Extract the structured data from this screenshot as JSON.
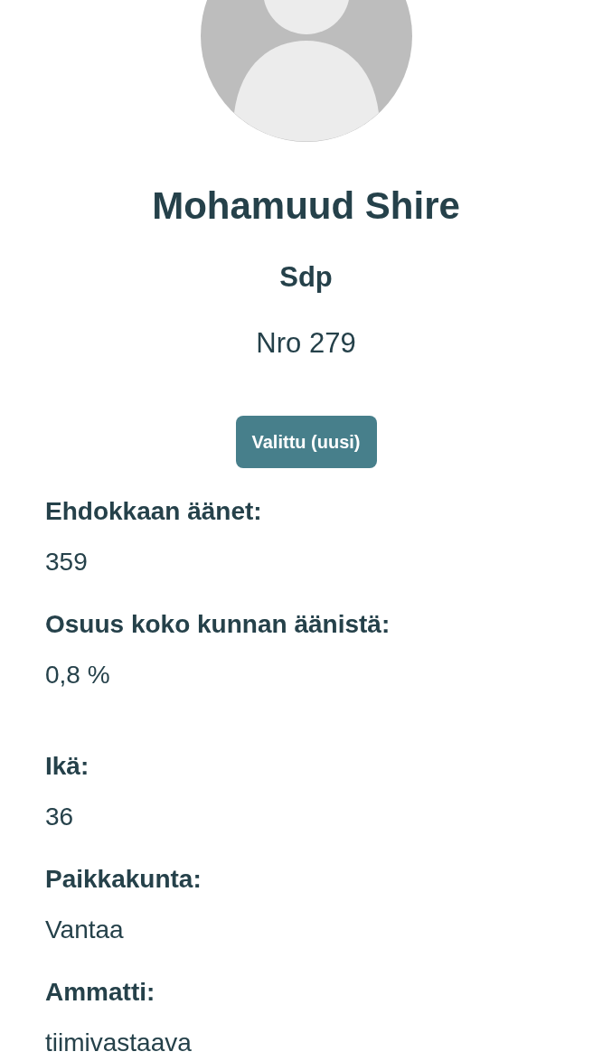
{
  "name": "Mohamuud Shire",
  "party": "Sdp",
  "number": "Nro 279",
  "badge": "Valittu (uusi)",
  "groups": [
    {
      "items": [
        {
          "label": "Ehdokkaan äänet:",
          "value": "359"
        },
        {
          "label": "Osuus koko kunnan äänistä:",
          "value": "0,8 %"
        }
      ]
    },
    {
      "items": [
        {
          "label": "Ikä:",
          "value": "36"
        },
        {
          "label": "Paikkakunta:",
          "value": "Vantaa"
        },
        {
          "label": "Ammatti:",
          "value": "tiimivastaava"
        }
      ]
    }
  ]
}
